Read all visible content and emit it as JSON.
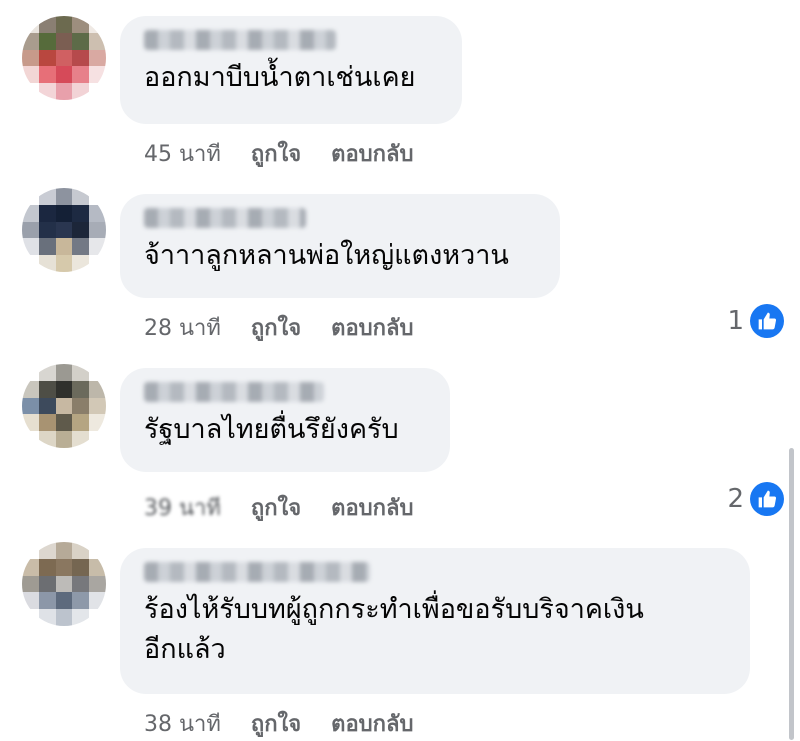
{
  "comments": [
    {
      "author": "",
      "text": "ออกมาบีบน้ำตาเช่นเคย",
      "time": "45 นาที",
      "like_label": "ถูกใจ",
      "reply_label": "ตอบกลับ",
      "reaction_count": ""
    },
    {
      "author": "",
      "text": "จ้าาาลูกหลานพ่อใหญ่แตงหวาน",
      "time": "28 นาที",
      "like_label": "ถูกใจ",
      "reply_label": "ตอบกลับ",
      "reaction_count": "1"
    },
    {
      "author": "",
      "text": "รัฐบาลไทยตื่นรึยังครับ",
      "time": "39 นาที",
      "like_label": "ถูกใจ",
      "reply_label": "ตอบกลับ",
      "reaction_count": "2"
    },
    {
      "author": "",
      "text": "ร้องไห้รับบทผู้ถูกกระทำเพื่อขอรับบริจาคเงินอีกแล้ว",
      "time": "38 นาที",
      "like_label": "ถูกใจ",
      "reply_label": "ตอบกลับ",
      "reaction_count": ""
    }
  ],
  "colors": {
    "bubble": "#f0f2f5",
    "like_badge": "#1877f2",
    "meta_text": "#65676b"
  }
}
